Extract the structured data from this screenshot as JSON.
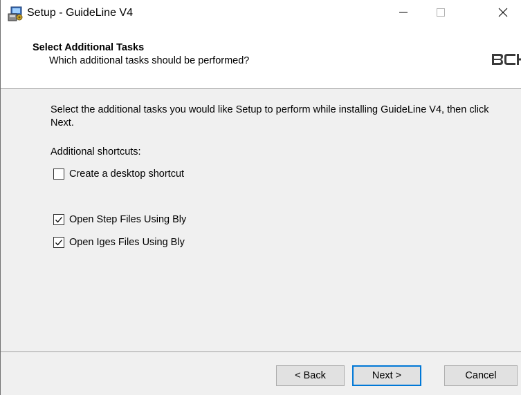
{
  "window": {
    "title": "Setup - GuideLine V4",
    "icon": "setup-installer-icon"
  },
  "caption_buttons": {
    "minimize_icon": "minimize-icon",
    "maximize_icon": "maximize-icon",
    "close_icon": "close-icon"
  },
  "header": {
    "title": "Select Additional Tasks",
    "subtitle": "Which additional tasks should be performed?",
    "logo_text": "BCH"
  },
  "main": {
    "description": "Select the additional tasks you would like Setup to perform while installing GuideLine V4, then click Next.",
    "group_label": "Additional shortcuts:",
    "tasks": [
      {
        "label": "Create a desktop shortcut",
        "checked": false
      },
      {
        "label": "Open Step Files Using Bly",
        "checked": true
      },
      {
        "label": "Open Iges Files Using Bly",
        "checked": true
      }
    ]
  },
  "footer": {
    "back_label": "< Back",
    "next_label": "Next >",
    "cancel_label": "Cancel"
  },
  "colors": {
    "accent": "#0078d7",
    "window_bg": "#f0f0f0",
    "header_bg": "#ffffff",
    "button_bg": "#e1e1e1"
  }
}
